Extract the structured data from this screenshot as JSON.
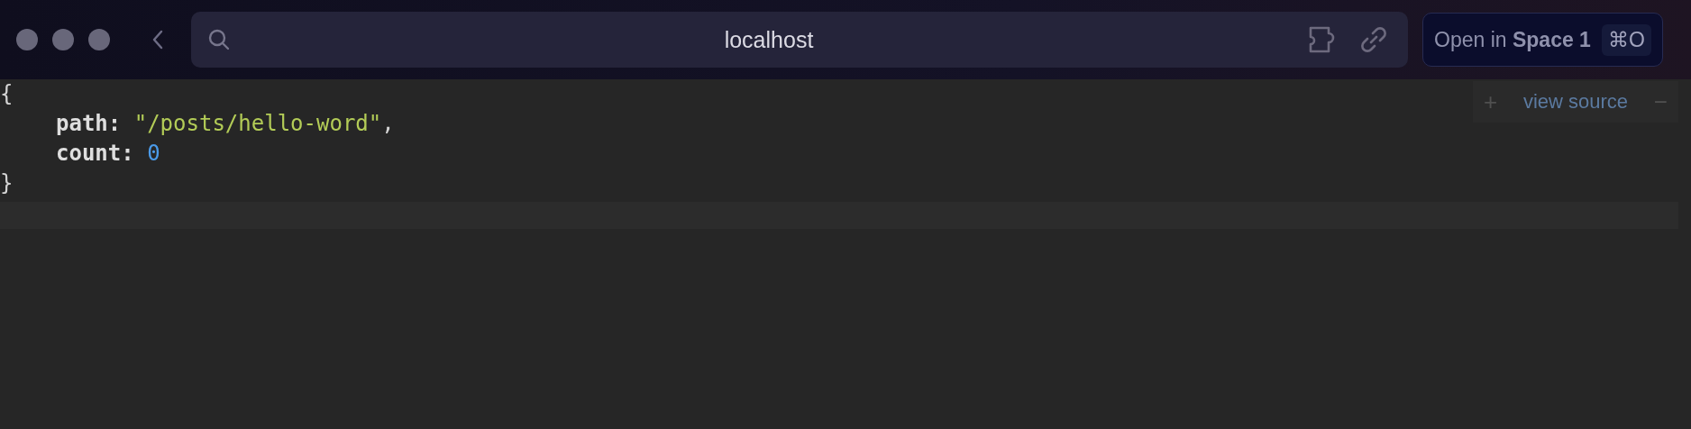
{
  "toolbar": {
    "address": "localhost",
    "open_button": {
      "label": "Open in **Space 1**",
      "shortcut": "⌘O"
    }
  },
  "json_view": {
    "open": "{",
    "entries": [
      {
        "key": "path:",
        "value": "\"/posts/hello-word\"",
        "kind": "string",
        "trailing": ","
      },
      {
        "key": "count:",
        "value": "0",
        "kind": "number"
      }
    ],
    "close": "}"
  },
  "source_panel": {
    "expand": "+",
    "label": "view source",
    "collapse": "−"
  }
}
